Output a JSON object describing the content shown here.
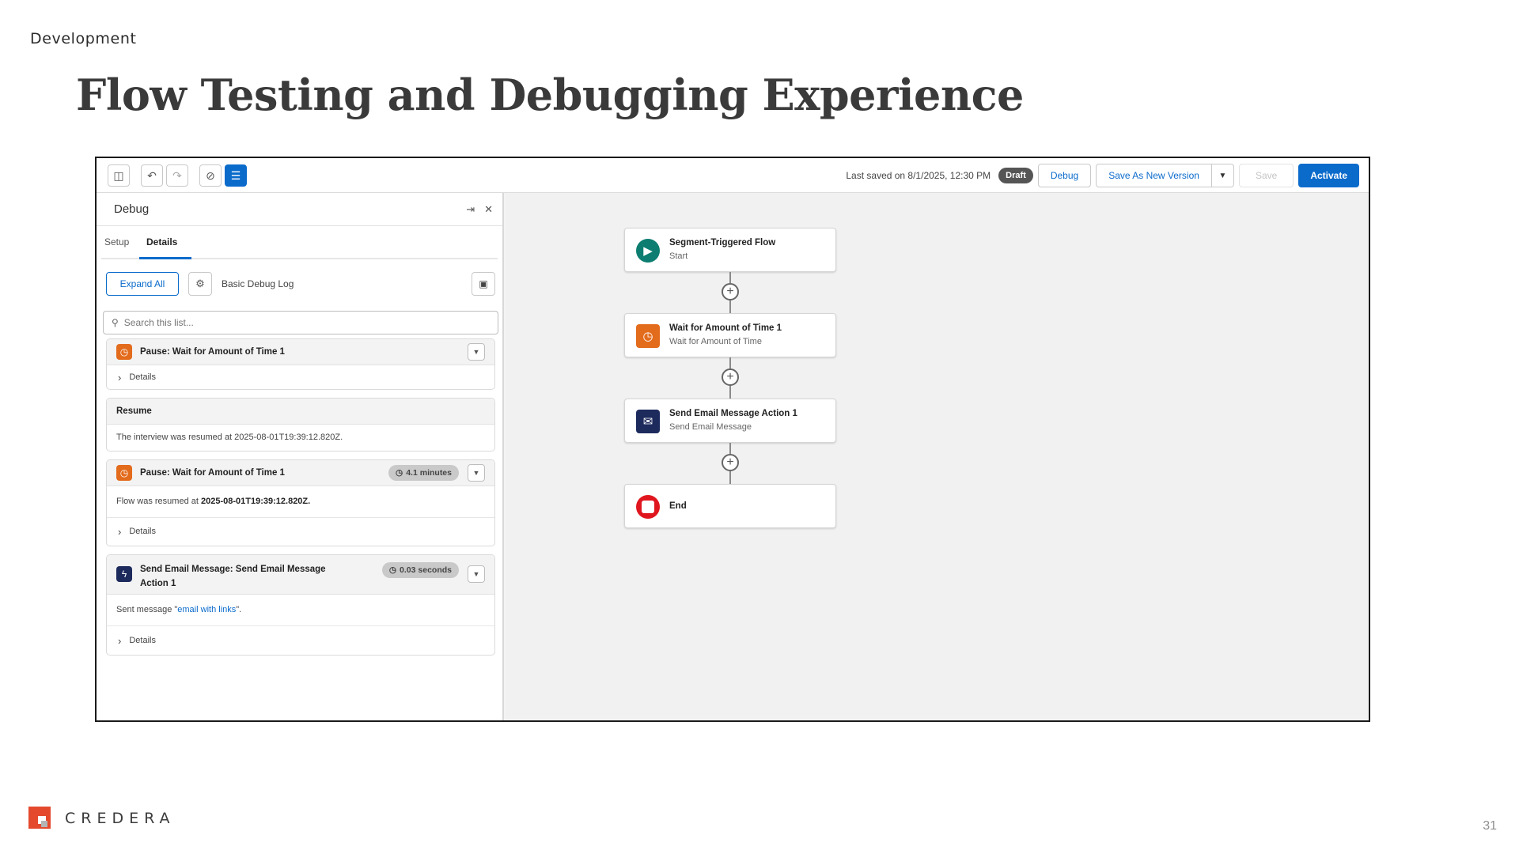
{
  "slide": {
    "section": "Development",
    "title": "Flow Testing and Debugging Experience",
    "page_number": "31",
    "brand": "CREDERA"
  },
  "toolbar": {
    "last_saved": "Last saved on 8/1/2025, 12:30 PM",
    "status_badge": "Draft",
    "debug_label": "Debug",
    "save_as_new_label": "Save As New Version",
    "save_label": "Save",
    "activate_label": "Activate"
  },
  "debug_panel": {
    "title": "Debug",
    "tabs": [
      "Setup",
      "Details"
    ],
    "active_tab": "Details",
    "expand_all_label": "Expand All",
    "log_level": "Basic Debug Log",
    "search_placeholder": "Search this list...",
    "entries": [
      {
        "title": "Pause: Wait for Amount of Time 1",
        "details_label": "Details"
      },
      {
        "title": "Resume",
        "message": "The interview was resumed at 2025-08-01T19:39:12.820Z."
      },
      {
        "title": "Pause: Wait for Amount of Time 1",
        "duration": "4.1 minutes",
        "message_prefix": "Flow was resumed at",
        "message_value": "2025-08-01T19:39:12.820Z.",
        "details_label": "Details"
      },
      {
        "title": "Send Email Message: Send Email Message",
        "title_line2": "Action 1",
        "duration": "0.03 seconds",
        "message_prefix": "Sent message \"",
        "message_link": "email with links",
        "message_suffix": "\".",
        "details_label": "Details"
      }
    ]
  },
  "flow_canvas": {
    "nodes": [
      {
        "title": "Segment-Triggered Flow",
        "subtitle": "Start",
        "icon": "play-icon",
        "color": "#0c7d70"
      },
      {
        "title": "Wait for Amount of Time 1",
        "subtitle": "Wait for Amount of Time",
        "icon": "clock-icon",
        "color": "#e36b1c"
      },
      {
        "title": "Send Email Message Action 1",
        "subtitle": "Send Email Message",
        "icon": "envelope-icon",
        "color": "#1d2a5c"
      },
      {
        "title": "End",
        "subtitle": "",
        "icon": "stop-icon",
        "color": "#e0161e"
      }
    ]
  },
  "colors": {
    "brand_blue": "#0b6bcb",
    "credera_red": "#e4492e"
  }
}
